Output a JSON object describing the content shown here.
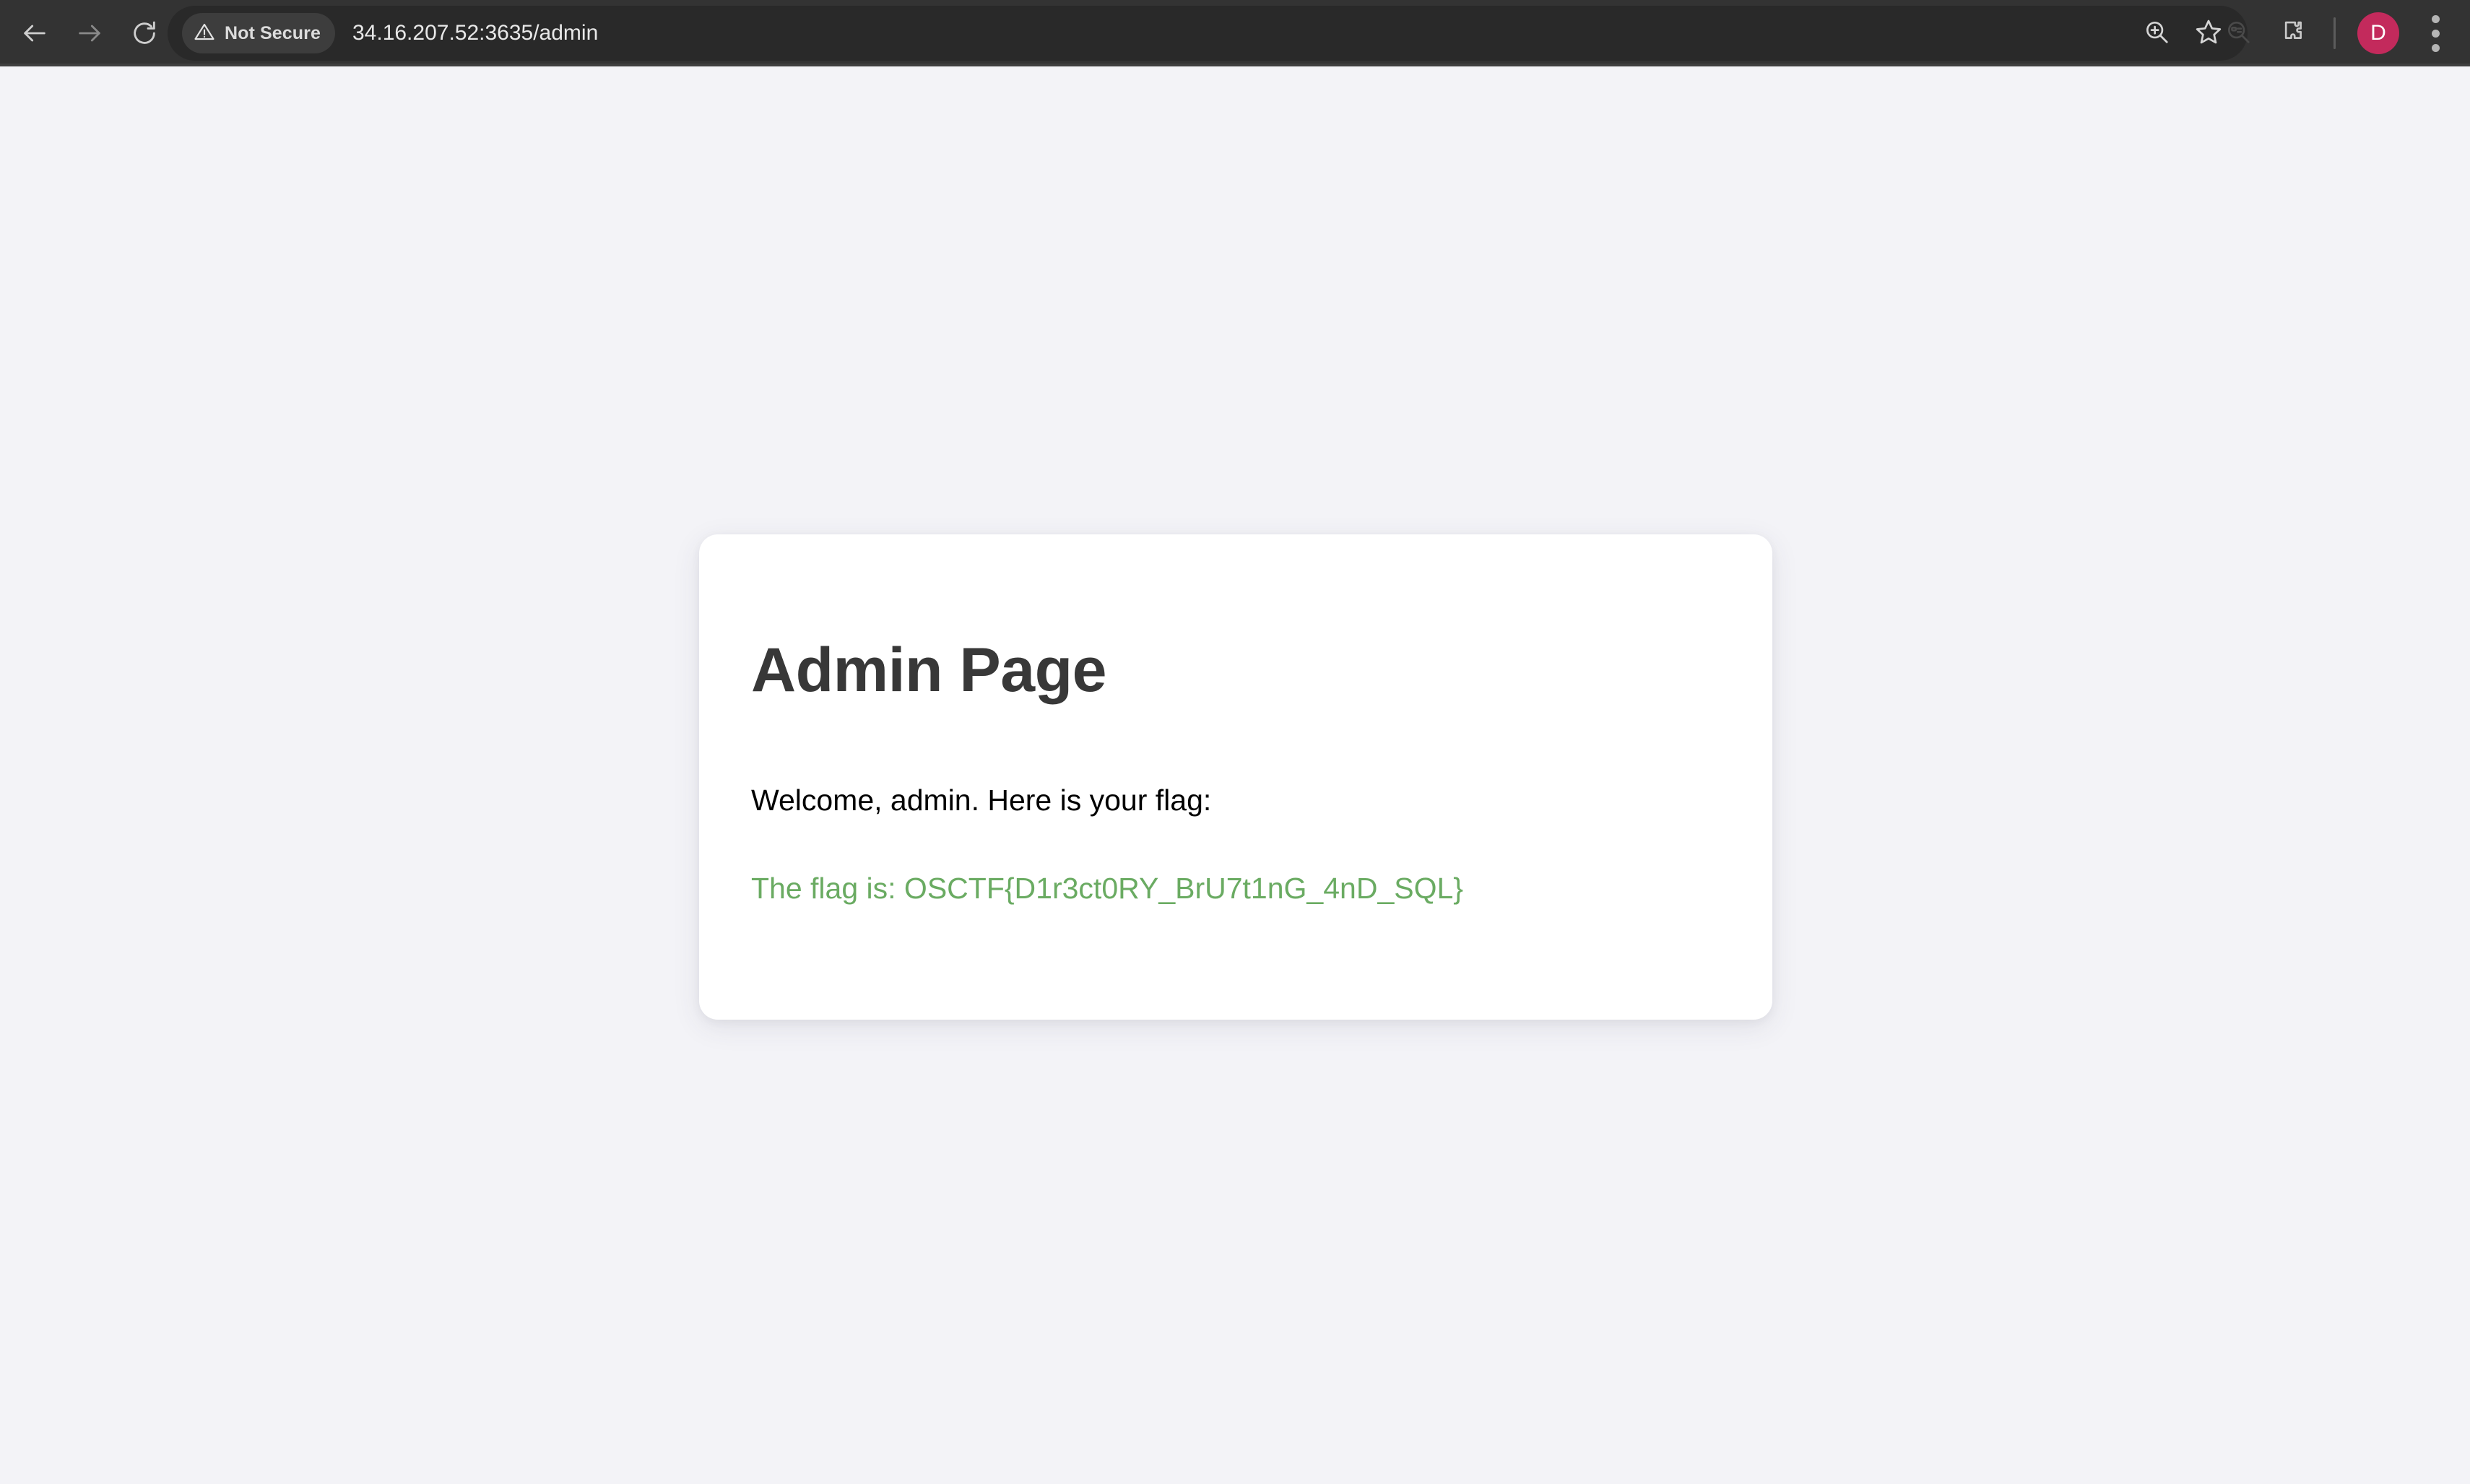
{
  "browser": {
    "nav": {
      "back_icon": "arrow-left-icon",
      "forward_icon": "arrow-right-icon",
      "reload_icon": "reload-icon"
    },
    "omnibox": {
      "security_label": "Not Secure",
      "security_icon": "warning-triangle-icon",
      "url": "34.16.207.52:3635/admin",
      "zoom_icon": "zoom-in-icon",
      "bookmark_icon": "star-icon"
    },
    "toolbar": {
      "search_tabs_icon": "search-tabs-icon",
      "extensions_icon": "puzzle-piece-icon",
      "avatar_initial": "D",
      "menu_icon": "three-dot-menu-icon"
    },
    "colors": {
      "chrome_bg": "#333333",
      "omnibox_bg": "#292929",
      "avatar_bg": "#c32a5c"
    }
  },
  "page": {
    "background_color": "#f3f3f7",
    "card": {
      "title": "Admin Page",
      "welcome": "Welcome, admin. Here is your flag:",
      "flag_line": "The flag is: OSCTF{D1r3ct0RY_BrU7t1nG_4nD_SQL}",
      "flag_color": "#6aab62",
      "background_color": "#ffffff"
    }
  }
}
